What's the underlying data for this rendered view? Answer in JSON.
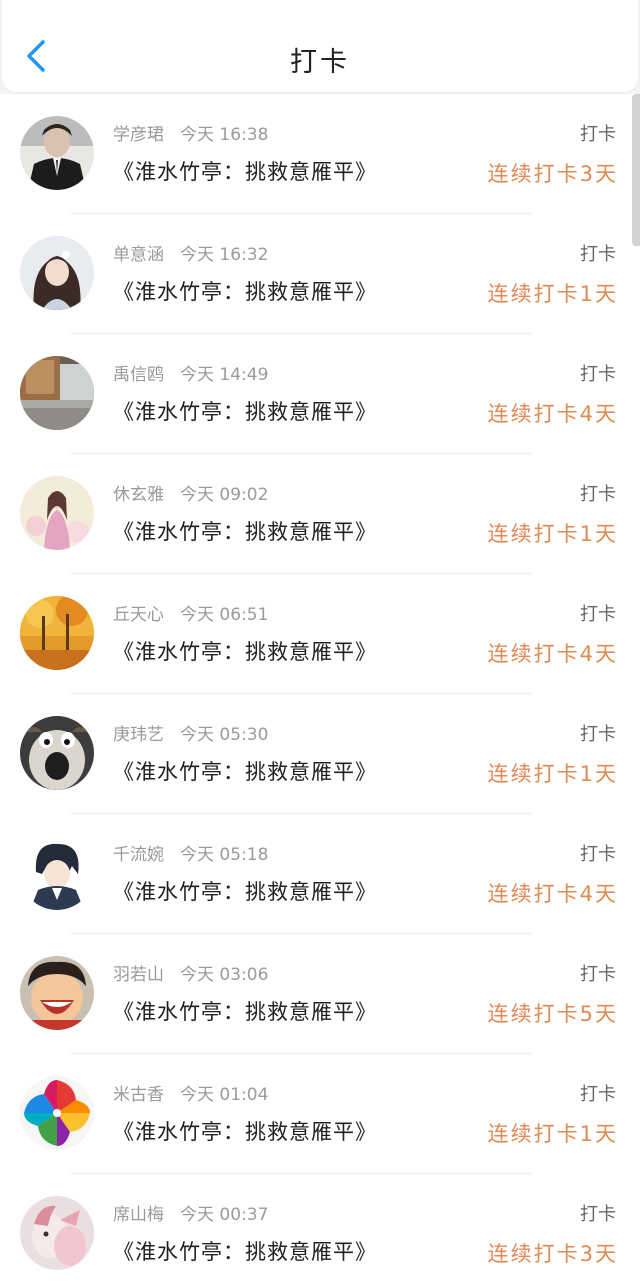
{
  "header": {
    "title": "打卡"
  },
  "colors": {
    "accent": "#2196f3",
    "streak": "#e08a52",
    "meta": "#9a9a9a"
  },
  "checkins": [
    {
      "name": "学彦珺",
      "time": "今天 16:38",
      "work": "《淮水竹亭：挑救意雁平》",
      "tag": "打卡",
      "streak": "连续打卡3天",
      "avatar": "man-in-suit"
    },
    {
      "name": "单意涵",
      "time": "今天 16:32",
      "work": "《淮水竹亭：挑救意雁平》",
      "tag": "打卡",
      "streak": "连续打卡1天",
      "avatar": "girl-portrait"
    },
    {
      "name": "禹信鸥",
      "time": "今天 14:49",
      "work": "《淮水竹亭：挑救意雁平》",
      "tag": "打卡",
      "streak": "连续打卡4天",
      "avatar": "bedroom-scene"
    },
    {
      "name": "休玄雅",
      "time": "今天 09:02",
      "work": "《淮水竹亭：挑救意雁平》",
      "tag": "打卡",
      "streak": "连续打卡1天",
      "avatar": "girl-in-flowers"
    },
    {
      "name": "丘天心",
      "time": "今天 06:51",
      "work": "《淮水竹亭：挑救意雁平》",
      "tag": "打卡",
      "streak": "连续打卡4天",
      "avatar": "autumn-forest"
    },
    {
      "name": "庚玮艺",
      "time": "今天 05:30",
      "work": "《淮水竹亭：挑救意雁平》",
      "tag": "打卡",
      "streak": "连续打卡1天",
      "avatar": "cartoon-dog"
    },
    {
      "name": "千流婉",
      "time": "今天 05:18",
      "work": "《淮水竹亭：挑救意雁平》",
      "tag": "打卡",
      "streak": "连续打卡4天",
      "avatar": "anime-boy"
    },
    {
      "name": "羽若山",
      "time": "今天 03:06",
      "work": "《淮水竹亭：挑救意雁平》",
      "tag": "打卡",
      "streak": "连续打卡5天",
      "avatar": "laughing-cartoon"
    },
    {
      "name": "米古香",
      "time": "今天 01:04",
      "work": "《淮水竹亭：挑救意雁平》",
      "tag": "打卡",
      "streak": "连续打卡1天",
      "avatar": "pinwheel"
    },
    {
      "name": "席山梅",
      "time": "今天 00:37",
      "work": "《淮水竹亭：挑救意雁平》",
      "tag": "打卡",
      "streak": "连续打卡3天",
      "avatar": "pink-illustration"
    }
  ]
}
